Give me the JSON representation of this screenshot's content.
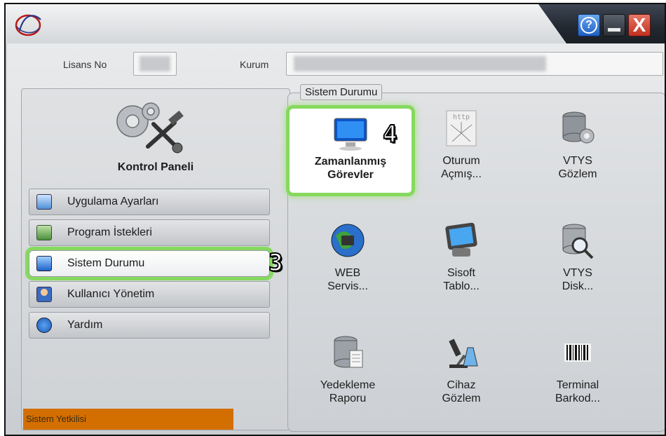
{
  "header": {
    "help_label": "?",
    "close_label": "X"
  },
  "info": {
    "license_label": "Lisans No",
    "institution_label": "Kurum"
  },
  "left_panel": {
    "title": "Kontrol Paneli",
    "items": [
      {
        "label": "Uygulama Ayarları",
        "icon": "settings-window-icon"
      },
      {
        "label": "Program İstekleri",
        "icon": "program-requests-icon"
      },
      {
        "label": "Sistem Durumu",
        "icon": "monitor-icon",
        "active": true
      },
      {
        "label": "Kullanıcı Yönetim",
        "icon": "users-icon"
      },
      {
        "label": "Yardım",
        "icon": "help-icon"
      }
    ],
    "badge": "3",
    "status_text": "Sistem Yetkilisi"
  },
  "right_panel": {
    "group_title": "Sistem Durumu",
    "badge": "4",
    "tiles": [
      {
        "label": "Zamanlanmış\nGörevler",
        "icon": "monitor-icon",
        "active": true
      },
      {
        "label": "Oturum\nAçmış...",
        "icon": "http-icon"
      },
      {
        "label": "VTYS\nGözlem",
        "icon": "database-gear-icon"
      },
      {
        "label": "WEB\nServis...",
        "icon": "globe-network-icon"
      },
      {
        "label": "Sisoft\nTablo...",
        "icon": "tablet-icon"
      },
      {
        "label": "VTYS\nDisk...",
        "icon": "database-search-icon"
      },
      {
        "label": "Yedekleme\nRaporu",
        "icon": "backup-report-icon"
      },
      {
        "label": "Cihaz\nGözlem",
        "icon": "microscope-icon"
      },
      {
        "label": "Terminal\nBarkod...",
        "icon": "barcode-icon"
      }
    ]
  },
  "colors": {
    "highlight": "#86d95f",
    "status_bar": "#d36f00",
    "titlebar": "#222830"
  }
}
